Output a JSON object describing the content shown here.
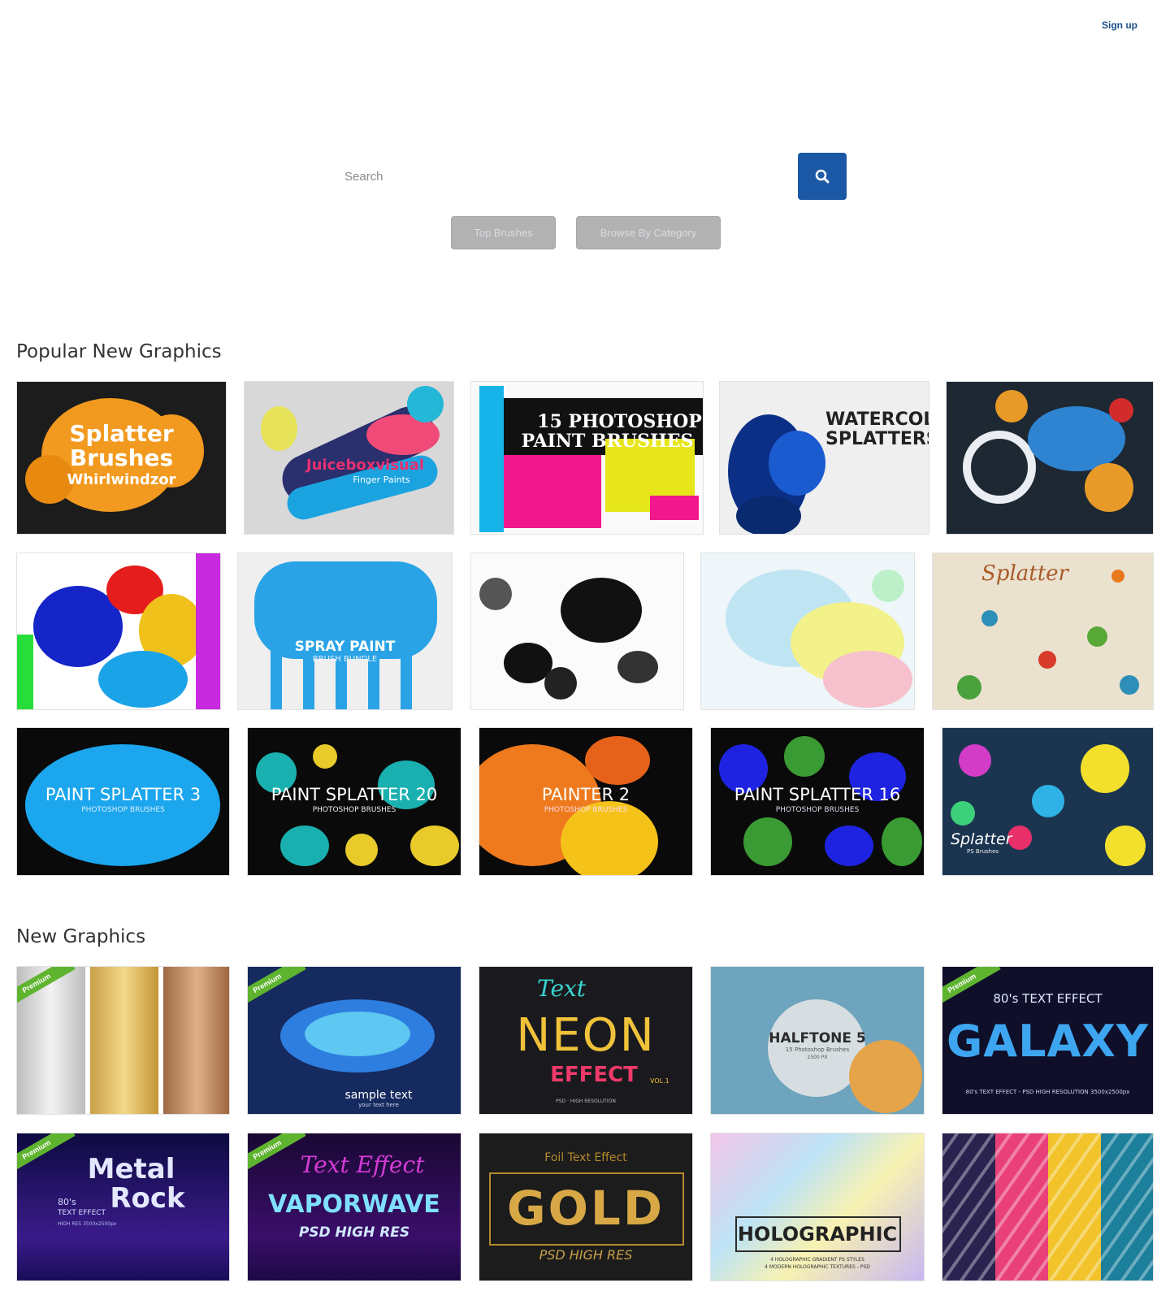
{
  "header": {
    "signup_label": "Sign up"
  },
  "search": {
    "placeholder": "Search"
  },
  "nav": {
    "top_brushes": "Top Brushes",
    "browse_by_category": "Browse By Category"
  },
  "popular": {
    "title": "Popular New Graphics",
    "items": [
      {
        "line1": "Splatter",
        "line2": "Brushes",
        "line3": "Whirlwindzor"
      },
      {
        "line1": "Juiceboxvisual",
        "line2": "Finger Paints"
      },
      {
        "line1": "15 PHOTOSHOP",
        "line2": "PAINT BRUSHES"
      },
      {
        "line1": "WATERCOLOR",
        "line2": "SPLATTERS"
      },
      {},
      {},
      {
        "line1": "SPRAY PAINT",
        "line2": "BRUSH BUNDLE"
      },
      {},
      {},
      {
        "line1": "Splatter"
      },
      {
        "line1": "PAINT SPLATTER 3",
        "line2": "PHOTOSHOP BRUSHES"
      },
      {
        "line1": "PAINT SPLATTER 20",
        "line2": "PHOTOSHOP BRUSHES"
      },
      {
        "line1": "PAINTER 2",
        "line2": "PHOTOSHOP BRUSHES"
      },
      {
        "line1": "PAINT SPLATTER 16",
        "line2": "PHOTOSHOP BRUSHES"
      },
      {
        "line1": "Splatter",
        "line2": "PS Brushes"
      }
    ]
  },
  "newgfx": {
    "title": "New Graphics",
    "badge": "Premium",
    "items": [
      {},
      {
        "line1": "sample text",
        "line2": "your text here"
      },
      {
        "line1": "Text",
        "line2": "NEON",
        "line3": "EFFECT",
        "line4": "VOL.1",
        "line5": "PSD · HIGH RESOLUTION"
      },
      {
        "line1": "HALFTONE 5",
        "line2": "15 Photoshop Brushes",
        "line3": "2500 PX"
      },
      {
        "line1": "80's TEXT EFFECT",
        "line2": "GALAXY",
        "line3": "80's TEXT EFFECT - PSD  HIGH RESOLUTION 3500x2500px"
      },
      {
        "line1": "Metal",
        "line2": "Rock",
        "line3": "80's",
        "line4": "TEXT EFFECT",
        "line5": "HIGH RES 3500x2500px"
      },
      {
        "line1": "Text Effect",
        "line2": "VAPORWAVE",
        "line3": "PSD HIGH RES"
      },
      {
        "line1": "Foil Text Effect",
        "line2": "GOLD",
        "line3": "PSD  HIGH RES"
      },
      {
        "line1": "HOLOGRAPHIC",
        "line2": "4 HOLOGRAPHIC GRADIENT PS STYLES",
        "line3": "4 MODERN HOLOGRAPHIC TEXTURES - PSD"
      },
      {}
    ]
  },
  "colors": {
    "accent": "#1b58a6",
    "pill": "#b2b2b2",
    "premium": "#5fb42f",
    "signup": "#1b4f8a"
  },
  "icons": {
    "search": "search-icon"
  }
}
